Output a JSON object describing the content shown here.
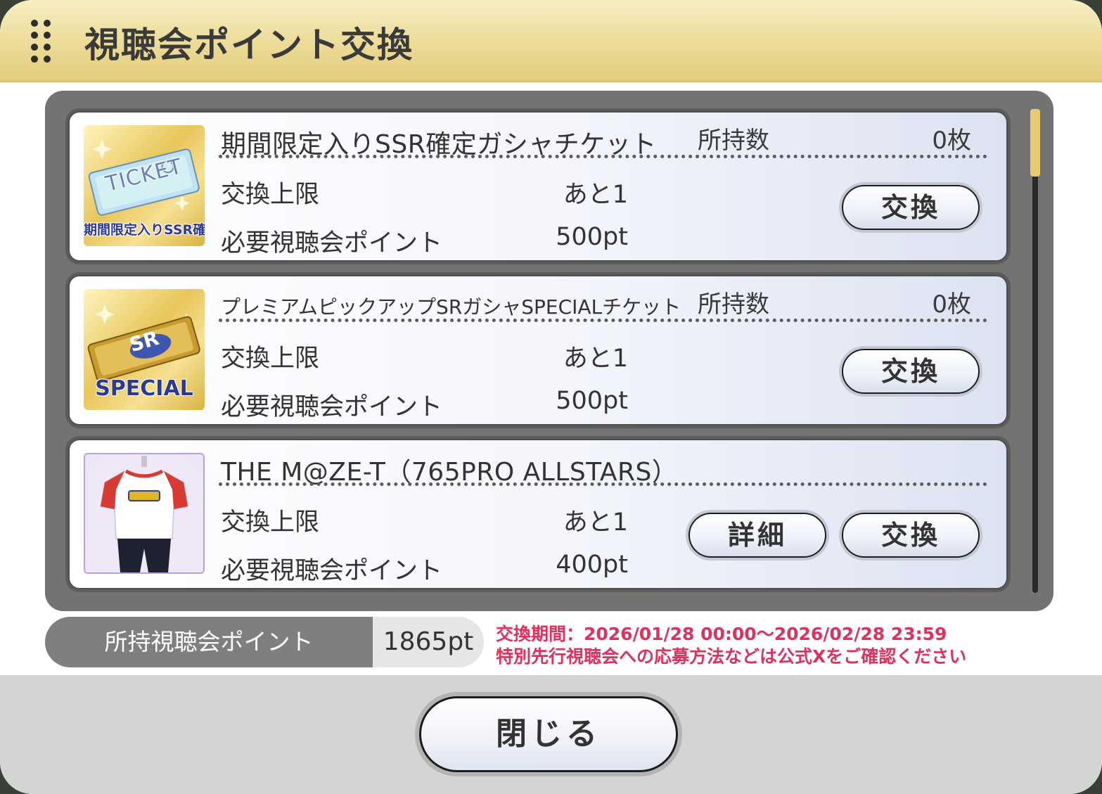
{
  "dialog": {
    "title": "視聴会ポイント交換",
    "drag_icon": "drag-handle-icon"
  },
  "labels": {
    "owned": "所持数",
    "limit": "交換上限",
    "required": "必要視聴会ポイント",
    "exchange_button": "交換",
    "detail_button": "詳細"
  },
  "items": [
    {
      "name": "期間限定入りSSR確定ガシャチケット",
      "thumbnail_text": "TICKET",
      "thumbnail_caption": "期間限定入りSSR確定",
      "owned": "0枚",
      "limit": "あと1",
      "required": "500pt"
    },
    {
      "name": "プレミアムピックアップSRガシャSPECIALチケット",
      "thumbnail_text": "SR",
      "thumbnail_caption": "SPECIAL",
      "owned": "0枚",
      "limit": "あと1",
      "required": "500pt"
    },
    {
      "name": "THE M@ZE-T（765PRO ALLSTARS）",
      "thumbnail_icon": "t-shirt-icon",
      "limit": "あと1",
      "required": "400pt"
    }
  ],
  "points": {
    "label": "所持視聴会ポイント",
    "value": "1865pt"
  },
  "notice": {
    "period": "交換期間：2026/01/28 00:00～2026/02/28 23:59",
    "info": "特別先行視聴会への応募方法などは公式Xをご確認ください"
  },
  "footer": {
    "close_label": "閉じる"
  },
  "colors": {
    "header_gold": "#ecdb97",
    "notice_pink": "#e0305e",
    "panel_gray": "#737373",
    "scroll_thumb": "#e6cc70"
  }
}
